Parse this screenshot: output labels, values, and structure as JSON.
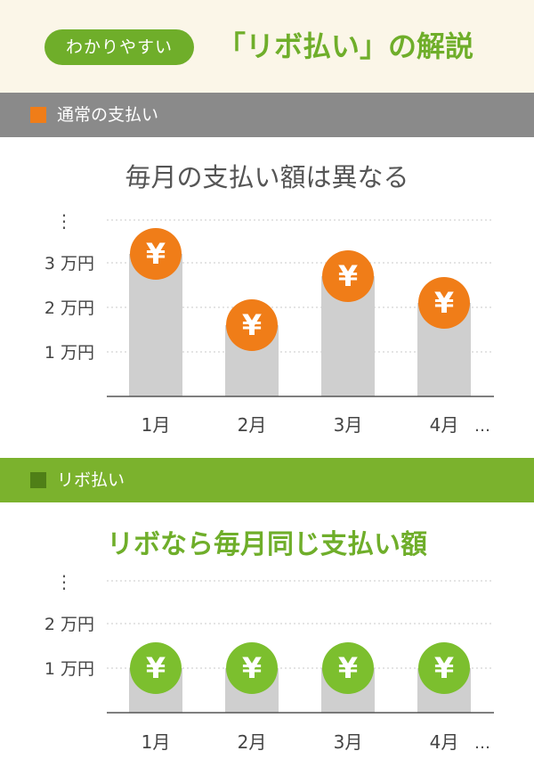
{
  "header": {
    "pill_label": "わかりやすい",
    "title": "「リボ払い」の解説"
  },
  "colors": {
    "accent_green": "#6fae2a",
    "accent_orange": "#f07d18",
    "bar_gray": "#cfcfcf",
    "band_gray": "#8a8a8a",
    "band_green": "#7bb22d"
  },
  "sections": [
    {
      "band_label": "通常の支払い",
      "subtitle": "毎月の支払い額は異なる"
    },
    {
      "band_label": "リボ払い",
      "subtitle": "リボなら毎月同じ支払い額"
    }
  ],
  "chart_data": [
    {
      "type": "bar",
      "title": "毎月の支払い額は異なる",
      "categories": [
        "1月",
        "2月",
        "3月",
        "4月"
      ],
      "category_suffix": "…",
      "values": [
        3.2,
        1.6,
        2.7,
        2.1
      ],
      "value_unit": "万円",
      "ytick_values": [
        1,
        2,
        3
      ],
      "ytick_labels": [
        "1 万円",
        "2 万円",
        "3 万円"
      ],
      "y_more": "⋮",
      "ylim": [
        0,
        4
      ],
      "marker_symbol": "¥",
      "marker_color": "#f07d18",
      "grid": true
    },
    {
      "type": "bar",
      "title": "リボなら毎月同じ支払い額",
      "categories": [
        "1月",
        "2月",
        "3月",
        "4月"
      ],
      "category_suffix": "…",
      "values": [
        1,
        1,
        1,
        1
      ],
      "value_unit": "万円",
      "ytick_values": [
        1,
        2
      ],
      "ytick_labels": [
        "1 万円",
        "2 万円"
      ],
      "y_more": "⋮",
      "ylim": [
        0,
        3
      ],
      "marker_symbol": "¥",
      "marker_color": "#7cbf2e",
      "grid": true
    }
  ]
}
